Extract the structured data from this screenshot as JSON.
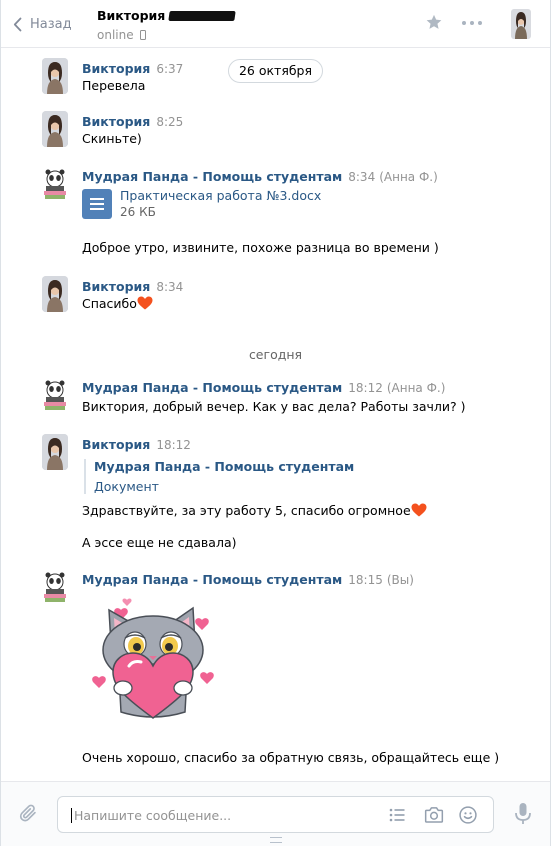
{
  "header": {
    "back_label": "Назад",
    "peer_name": "Виктория",
    "peer_status": "online",
    "icons": [
      "chevron-left-icon",
      "star-icon",
      "more-icon",
      "phone-icon"
    ]
  },
  "messages": [
    {
      "author": "Виктория",
      "time": "6:37",
      "text": "Перевела"
    },
    {
      "author": "Виктория",
      "time": "8:25",
      "text": "Скиньте)"
    },
    {
      "author": "Мудрая Панда - Помощь студентам",
      "time": "8:34",
      "sender_note": "(Анна Ф.)",
      "attachment": {
        "name": "Практическая работа №3.docx",
        "size": "26 КБ"
      },
      "text": "Доброе утро, извините, похоже разница во времени )"
    },
    {
      "author": "Виктория",
      "time": "8:34",
      "text": "Спасибо"
    },
    {
      "author": "Мудрая Панда - Помощь студентам",
      "time": "18:12",
      "sender_note": "(Анна Ф.)",
      "text": "Виктория, добрый вечер. Как у вас дела? Работы зачли? )"
    },
    {
      "author": "Виктория",
      "time": "18:12",
      "forwarded": {
        "author": "Мудрая Панда - Помощь студентам",
        "label": "Документ"
      },
      "text": "Здравствуйте, за эту работу 5, спасибо огромное",
      "text2": "А эссе еще не сдавала)"
    },
    {
      "author": "Мудрая Панда - Помощь студентам",
      "time": "18:15",
      "sender_note": "(Вы)",
      "text": "Очень хорошо, спасибо за обратную связь, обращайтесь еще )"
    }
  ],
  "date_separators": {
    "pill": "26 октября",
    "today": "сегодня"
  },
  "composer": {
    "placeholder": "Напишите сообщение...",
    "icons": [
      "paperclip-icon",
      "list-icon",
      "camera-icon",
      "smile-icon",
      "microphone-icon"
    ]
  },
  "colors": {
    "link": "#2a5885",
    "muted": "#939393",
    "accent": "#5181b8",
    "heart": "#f4511e"
  }
}
